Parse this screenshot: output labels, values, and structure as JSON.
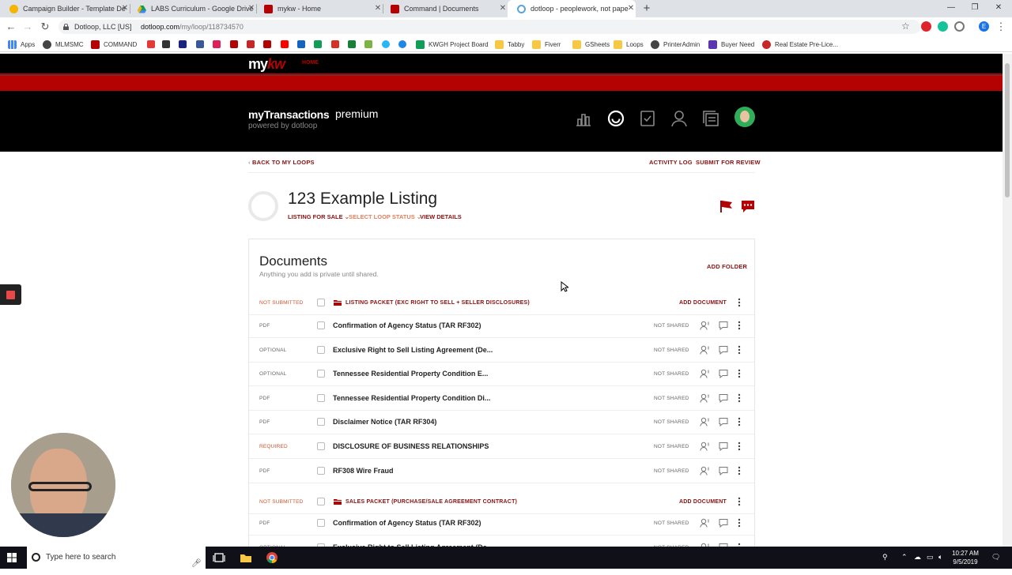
{
  "browser": {
    "tabs": [
      {
        "label": "Campaign Builder - Template De",
        "icon_color": "#f4b400"
      },
      {
        "label": "LABS Curriculum - Google Drive",
        "icon_color": "#0f9d58"
      },
      {
        "label": "mykw - Home",
        "icon_color": "#b40101"
      },
      {
        "label": "Command | Documents",
        "icon_color": "#b40101"
      },
      {
        "label": "dotloop - peoplework, not pape",
        "icon_color": "#5aa4d8"
      }
    ],
    "address": {
      "site_label": "Dotloop, LLC [US]",
      "url_host": "dotloop.com",
      "url_path": "/my/loop/118734570"
    },
    "bookmarks": [
      "Apps",
      "MLMSMC",
      "COMMAND",
      "KWGH Project Board",
      "Tabby",
      "Fiverr",
      "GSheets",
      "Loops",
      "PrinterAdmin",
      "Buyer Need",
      "Real Estate Pre-Lice..."
    ],
    "profile_initial": "E"
  },
  "header": {
    "brand_my": "my",
    "brand_kw": "kw",
    "home_link": "HOME",
    "app_title": "myTransactions",
    "tier": "premium",
    "powered": "powered by dotloop"
  },
  "loop": {
    "back_link": "BACK TO MY LOOPS",
    "activity_log": "ACTIVITY LOG",
    "submit_review": "SUBMIT FOR REVIEW",
    "title": "123 Example Listing",
    "type_label": "LISTING FOR SALE",
    "status_label": "SELECT LOOP STATUS",
    "view_details": "VIEW DETAILS"
  },
  "documents": {
    "heading": "Documents",
    "subheading": "Anything you add is private until shared.",
    "add_folder": "ADD FOLDER",
    "add_document": "ADD DOCUMENT",
    "share_status": "NOT SHARED",
    "packets": [
      {
        "status": "NOT SUBMITTED",
        "name": "LISTING PACKET (EXC RIGHT TO SELL + SELLER DISCLOSURES)",
        "docs": [
          {
            "tag": "PDF",
            "name": "Confirmation of Agency Status (TAR RF302)"
          },
          {
            "tag": "OPTIONAL",
            "name": "Exclusive Right to Sell Listing Agreement (De..."
          },
          {
            "tag": "OPTIONAL",
            "name": "Tennessee Residential Property Condition E..."
          },
          {
            "tag": "PDF",
            "name": "Tennessee Residential Property Condition Di..."
          },
          {
            "tag": "PDF",
            "name": "Disclaimer Notice (TAR RF304)"
          },
          {
            "tag": "REQUIRED",
            "name": "DISCLOSURE OF BUSINESS RELATIONSHIPS"
          },
          {
            "tag": "PDF",
            "name": "RF308 Wire Fraud"
          }
        ]
      },
      {
        "status": "NOT SUBMITTED",
        "name": "SALES PACKET (PURCHASE/SALE AGREEMENT CONTRACT)",
        "docs": [
          {
            "tag": "PDF",
            "name": "Confirmation of Agency Status (TAR RF302)"
          },
          {
            "tag": "OPTIONAL",
            "name": "Exclusive Right to Sell Listing Agreement (De..."
          }
        ]
      }
    ]
  },
  "taskbar": {
    "search_placeholder": "Type here to search",
    "time": "10:27 AM",
    "date": "9/5/2019"
  },
  "colors": {
    "brand_red": "#b40101",
    "link_red": "#8a1010",
    "status_orange": "#d0532b"
  }
}
